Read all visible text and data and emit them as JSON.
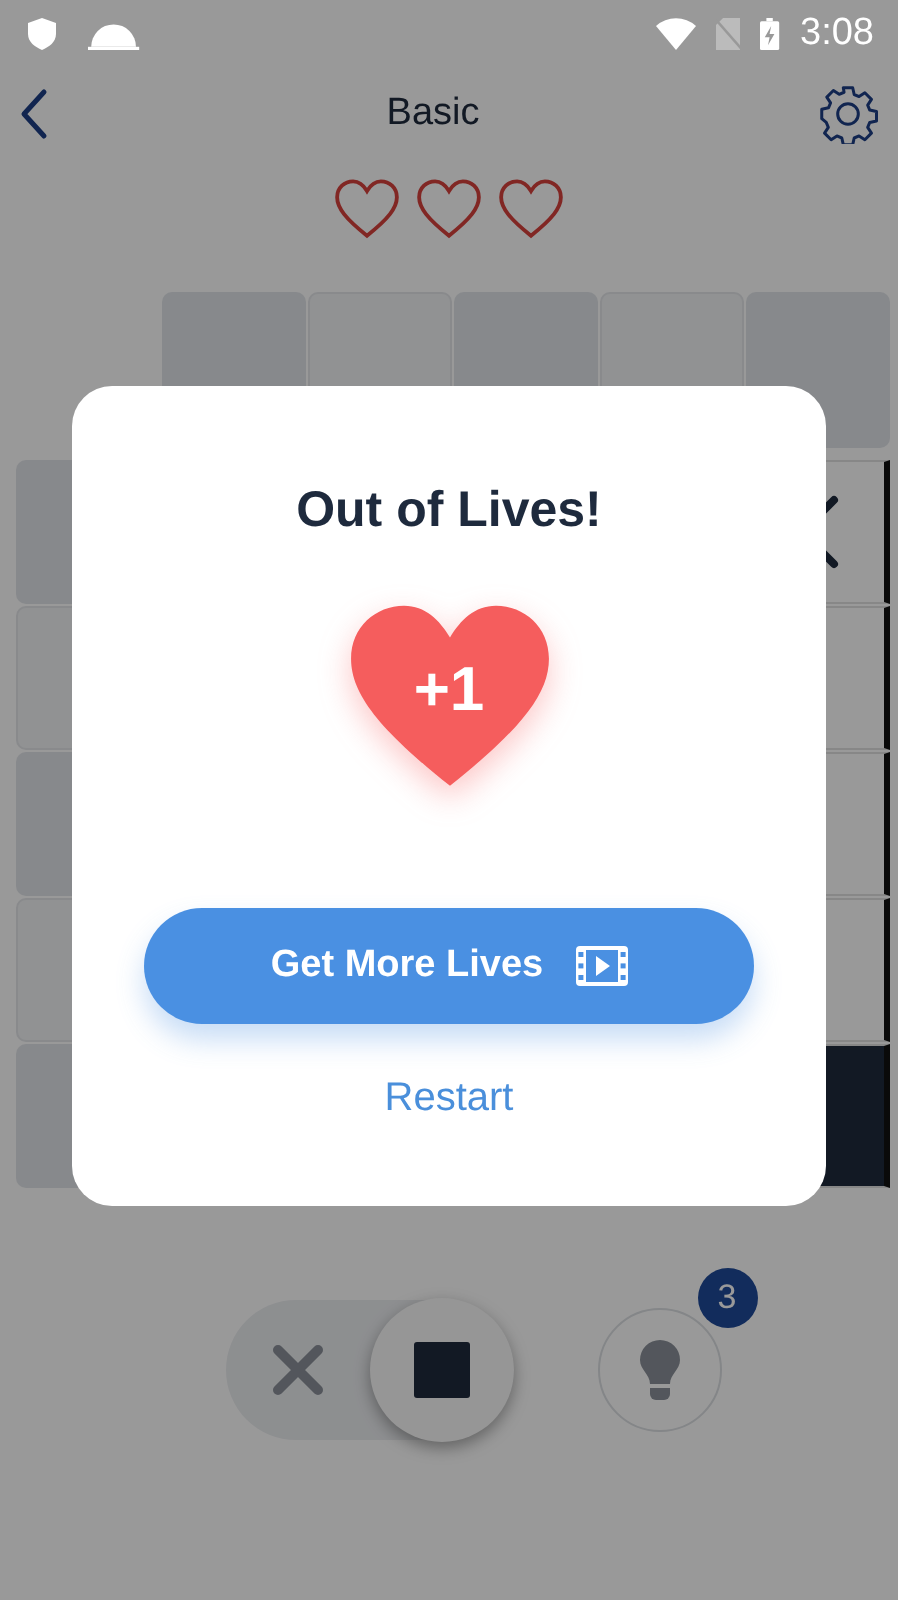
{
  "status_bar": {
    "time": "3:08"
  },
  "header": {
    "title": "Basic"
  },
  "lives": [
    {
      "filled": false
    },
    {
      "filled": false
    },
    {
      "filled": false
    }
  ],
  "board_last_column": [
    {
      "filled": false,
      "crossed": true
    },
    {
      "filled": false,
      "crossed": false
    },
    {
      "filled": false,
      "crossed": false
    },
    {
      "filled": false,
      "crossed": false
    },
    {
      "filled": true,
      "crossed": false
    }
  ],
  "mode_toggle": {
    "options": [
      {
        "kind": "cross",
        "selected": false
      },
      {
        "kind": "fill",
        "selected": true
      }
    ]
  },
  "hint": {
    "badge": "3"
  },
  "dialog": {
    "title": "Out of Lives!",
    "reward": "+1",
    "primary_button": "Get More Lives",
    "secondary_button": "Restart"
  }
}
